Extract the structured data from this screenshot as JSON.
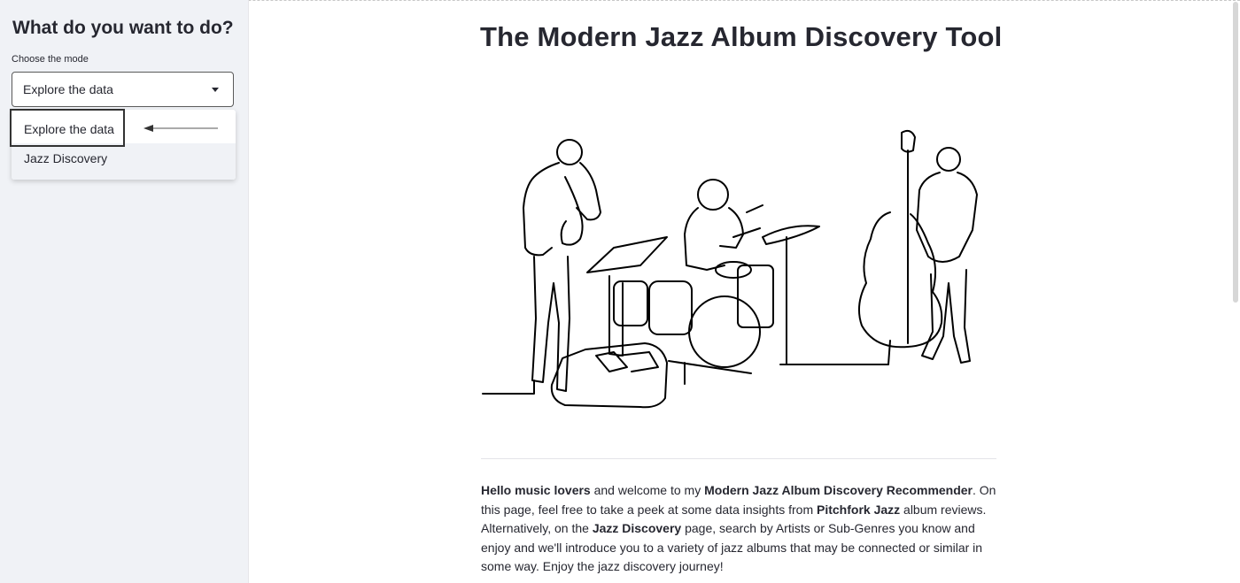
{
  "sidebar": {
    "title": "What do you want to do?",
    "mode_label": "Choose the mode",
    "selected_value": "Explore the data",
    "options": [
      "Explore the data",
      "Jazz Discovery"
    ]
  },
  "main": {
    "title": "The Modern Jazz Album Discovery Tool",
    "intro": {
      "p1_bold": "Hello music lovers",
      "p2": " and welcome to my ",
      "p3_bold": "Modern Jazz Album Discovery Recommender",
      "p4": ". On this page, feel free to take a peek at some data insights from ",
      "p5_bold": "Pitchfork Jazz",
      "p6": " album reviews. Alternatively, on the ",
      "p7_bold": "Jazz Discovery",
      "p8": " page, search by Artists or Sub-Genres you know and enjoy and we'll introduce you to a variety of jazz albums that may be connected or similar in some way. Enjoy the jazz discovery journey!"
    },
    "illustration_icon": "jazz-trio-line-drawing"
  },
  "colors": {
    "sidebar_bg": "#f0f2f6",
    "text": "#262730",
    "option_hover": "#f0f2f6"
  }
}
